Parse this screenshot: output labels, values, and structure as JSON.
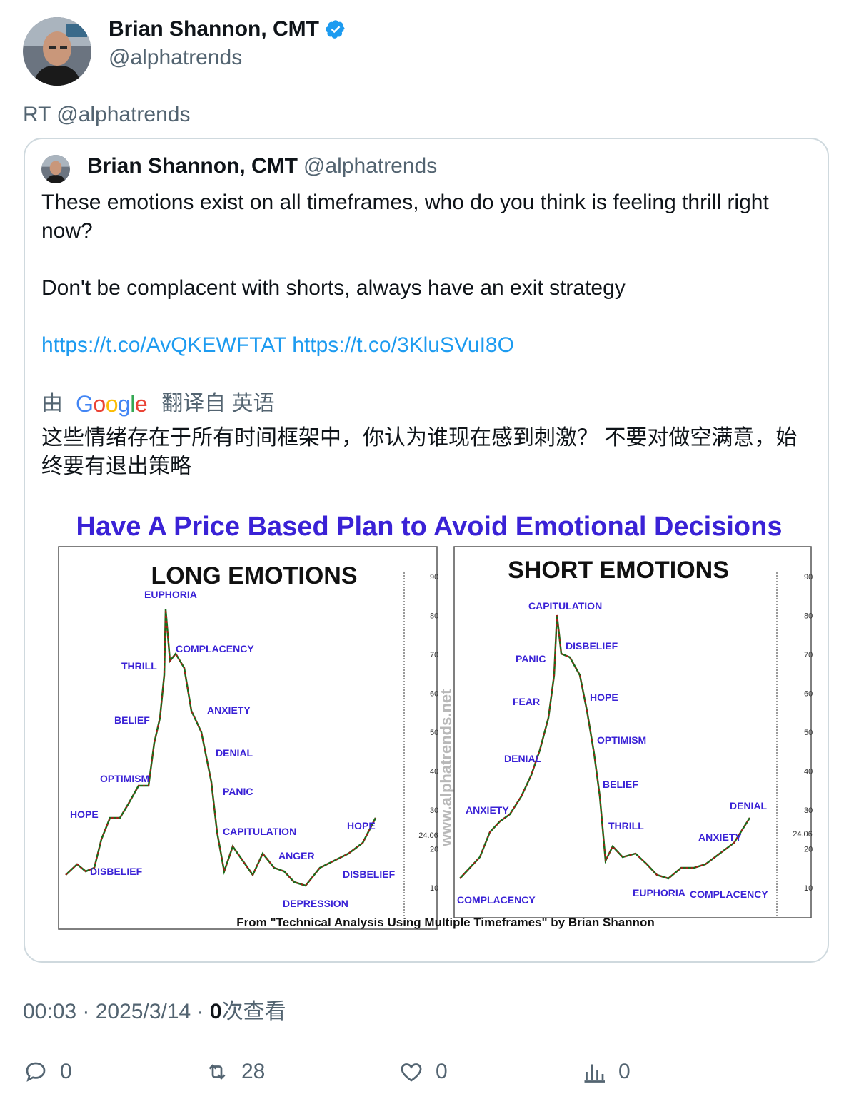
{
  "author": {
    "name": "Brian Shannon, CMT",
    "handle": "@alphatrends"
  },
  "retweet_label": "RT @alphatrends",
  "quoted": {
    "name": "Brian Shannon, CMT",
    "handle": "@alphatrends",
    "text_line1": "These emotions exist on all timeframes, who do you think is feeling thrill right now?",
    "text_line2": "Don't be complacent with shorts, always have an exit strategy",
    "link1": "https://t.co/AvQKEWFTAT",
    "link2": "https://t.co/3KluSVuI8O",
    "translation": {
      "prefix": "由",
      "provider": "Google",
      "suffix": "翻译自 英语",
      "text": "这些情绪存在于所有时间框架中，你认为谁现在感到刺激？ 不要对做空满意，始终要有退出策略"
    },
    "image": {
      "headline": "Have A Price Based Plan to Avoid Emotional Decisions",
      "left_title": "LONG EMOTIONS",
      "right_title": "SHORT EMOTIONS",
      "watermark": "www.alphatrends.net",
      "credit": "From \"Technical Analysis Using Multiple Timeframes\" by Brian Shannon",
      "price_label": "24.06",
      "axis_ticks": [
        "90",
        "80",
        "70",
        "60",
        "50",
        "40",
        "30",
        "20",
        "10"
      ],
      "long_labels": [
        "EUPHORIA",
        "COMPLACENCY",
        "THRILL",
        "BELIEF",
        "ANXIETY",
        "DENIAL",
        "OPTIMISM",
        "PANIC",
        "HOPE",
        "CAPITULATION",
        "HOPE",
        "ANGER",
        "DISBELIEF",
        "DISBELIEF",
        "DEPRESSION"
      ],
      "short_labels": [
        "CAPITULATION",
        "DISBELIEF",
        "PANIC",
        "FEAR",
        "HOPE",
        "OPTIMISM",
        "DENIAL",
        "BELIEF",
        "ANXIETY",
        "THRILL",
        "DENIAL",
        "ANXIETY",
        "COMPLACENCY",
        "EUPHORIA",
        "COMPLACENCY"
      ]
    }
  },
  "meta": {
    "time": "00:03",
    "date": "2025/3/14",
    "views_count": "0",
    "views_label": "次查看"
  },
  "actions": {
    "replies": "0",
    "retweets": "28",
    "likes": "0",
    "views": "0"
  },
  "colors": {
    "link": "#1d9bf0",
    "secondary_text": "#536471",
    "verified": "#1d9bf0",
    "headline": "#3a22d6",
    "label": "#3a22d6"
  }
}
